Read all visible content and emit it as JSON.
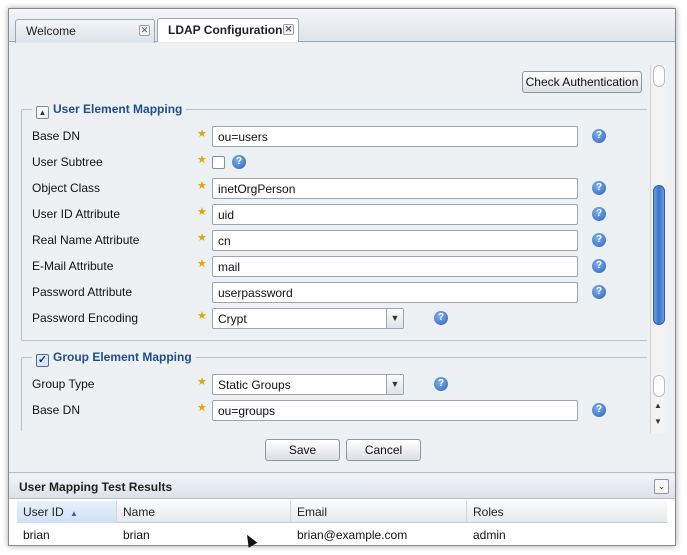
{
  "tabs": [
    {
      "label": "Welcome",
      "active": false
    },
    {
      "label": "LDAP Configuration",
      "active": true
    }
  ],
  "toolbar": {
    "check_auth_label": "Check Authentication"
  },
  "user_mapping": {
    "legend": "User Element Mapping",
    "rows": [
      {
        "label": "Base DN",
        "required": true,
        "type": "text",
        "value": "ou=users"
      },
      {
        "label": "User Subtree",
        "required": true,
        "type": "checkbox",
        "checked": false
      },
      {
        "label": "Object Class",
        "required": true,
        "type": "text",
        "value": "inetOrgPerson"
      },
      {
        "label": "User ID Attribute",
        "required": true,
        "type": "text",
        "value": "uid"
      },
      {
        "label": "Real Name Attribute",
        "required": true,
        "type": "text",
        "value": "cn"
      },
      {
        "label": "E-Mail Attribute",
        "required": true,
        "type": "text",
        "value": "mail"
      },
      {
        "label": "Password Attribute",
        "required": false,
        "type": "text",
        "value": "userpassword"
      },
      {
        "label": "Password Encoding",
        "required": true,
        "type": "select",
        "value": "Crypt"
      }
    ]
  },
  "group_mapping": {
    "legend": "Group Element Mapping",
    "enabled": true,
    "rows": [
      {
        "label": "Group Type",
        "required": true,
        "type": "select",
        "value": "Static Groups"
      },
      {
        "label": "Base DN",
        "required": true,
        "type": "text",
        "value": "ou=groups"
      }
    ]
  },
  "actions": {
    "save_label": "Save",
    "cancel_label": "Cancel"
  },
  "results": {
    "title": "User Mapping Test Results",
    "columns": [
      "User ID",
      "Name",
      "Email",
      "Roles"
    ],
    "rows": [
      [
        "brian",
        "brian",
        "brian@example.com",
        "admin"
      ]
    ]
  },
  "icons": {
    "required": "star-icon",
    "help": "help-icon",
    "sort": "sort-ascending-icon"
  },
  "colors": {
    "accent": "#1e4e8c",
    "scroll_thumb": "#3b74cf",
    "required_star": "#e4a700"
  }
}
